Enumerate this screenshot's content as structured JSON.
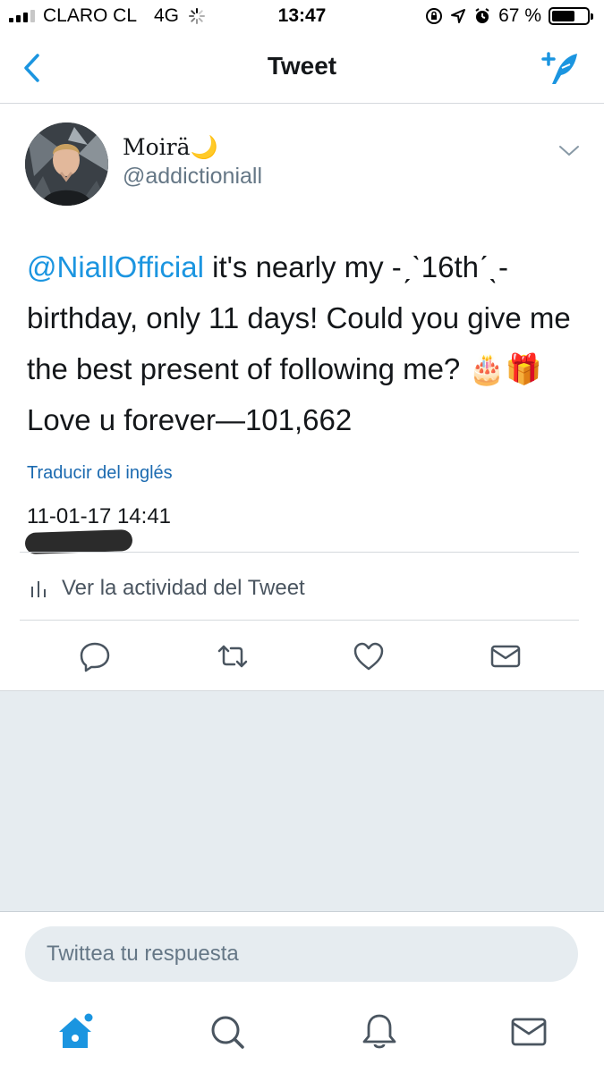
{
  "status_bar": {
    "carrier": "CLARO CL",
    "network": "4G",
    "time": "13:47",
    "battery": "67 %",
    "battery_level": 0.67
  },
  "nav": {
    "title": "Tweet"
  },
  "tweet": {
    "display_name": "Moirä",
    "display_name_emoji": "🌙",
    "handle": "@addictioniall",
    "mention": "@NiallOfficial",
    "text": " it's nearly my -ˏˋ16thˊˎ- birthday, only 11 days! Could you give me the best present of following me? 🎂🎁Love u forever—101,662",
    "translate": "Traducir del inglés",
    "timestamp": "11-01-17 14:41",
    "activity": "Ver la actividad del Tweet"
  },
  "reply": {
    "placeholder": "Twittea tu respuesta"
  },
  "colors": {
    "accent": "#1b95e0",
    "secondary_text": "#657786",
    "background_gray": "#e6ecf0"
  }
}
